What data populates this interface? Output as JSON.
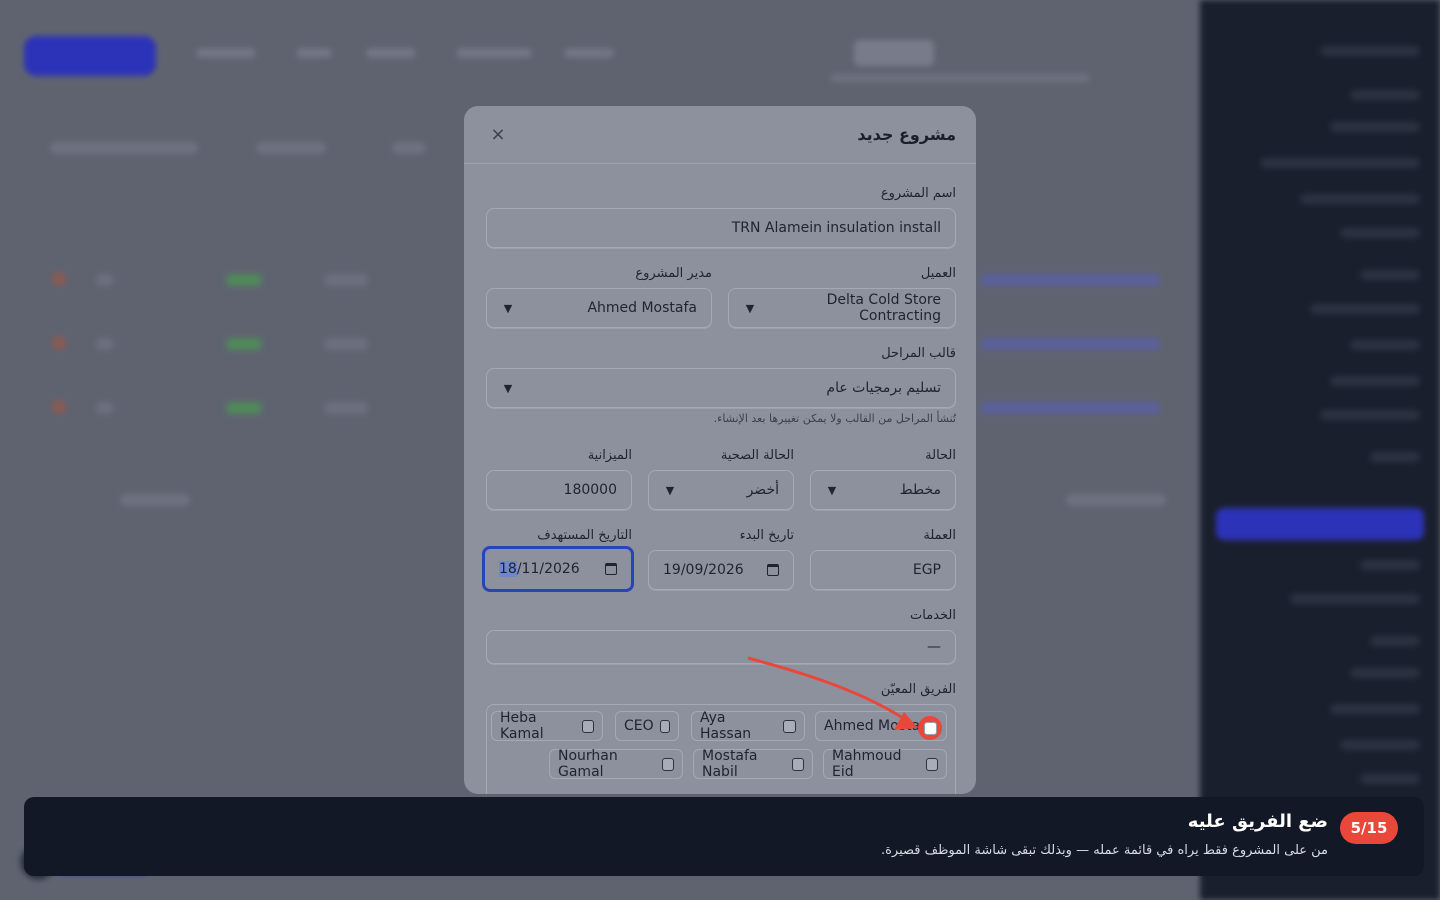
{
  "modal": {
    "title": "مشروع جديد",
    "close_icon": "×",
    "project_name": {
      "label": "اسم المشروع",
      "value": "TRN Alamein insulation install"
    },
    "client": {
      "label": "العميل",
      "value": "Delta Cold Store Contracting"
    },
    "manager": {
      "label": "مدير المشروع",
      "value": "Ahmed Mostafa"
    },
    "template": {
      "label": "قالب المراحل",
      "value": "تسليم برمجيات عام",
      "hint": "تُنشأ المراحل من القالب ولا يمكن تغييرها بعد الإنشاء."
    },
    "status": {
      "label": "الحالة",
      "value": "مخطط"
    },
    "health": {
      "label": "الحالة الصحية",
      "value": "أخضر"
    },
    "budget": {
      "label": "الميزانية",
      "value": "180000"
    },
    "currency": {
      "label": "العملة",
      "value": "EGP"
    },
    "start_date": {
      "label": "تاريخ البدء",
      "value": "19/09/2026"
    },
    "target_date": {
      "label": "التاريخ المستهدف",
      "day": "18",
      "rest": "/11/2026"
    },
    "services": {
      "label": "الخدمات",
      "value": "—"
    },
    "team": {
      "label": "الفريق المعيّن",
      "members": [
        "Ahmed Mostafa",
        "Aya Hassan",
        "CEO",
        "Heba Kamal",
        "Mahmoud Eid",
        "Mostafa Nabil",
        "Nourhan Gamal"
      ]
    }
  },
  "tour": {
    "step": "5/15",
    "title": "ضع الفريق عليه",
    "description": "من على المشروع فقط يراه في قائمة عمله — وبذلك تبقى شاشة الموظف قصيرة."
  },
  "colors": {
    "accent": "#2b43b8",
    "tour_badge": "#e8473a",
    "tour_bg": "#131827"
  }
}
